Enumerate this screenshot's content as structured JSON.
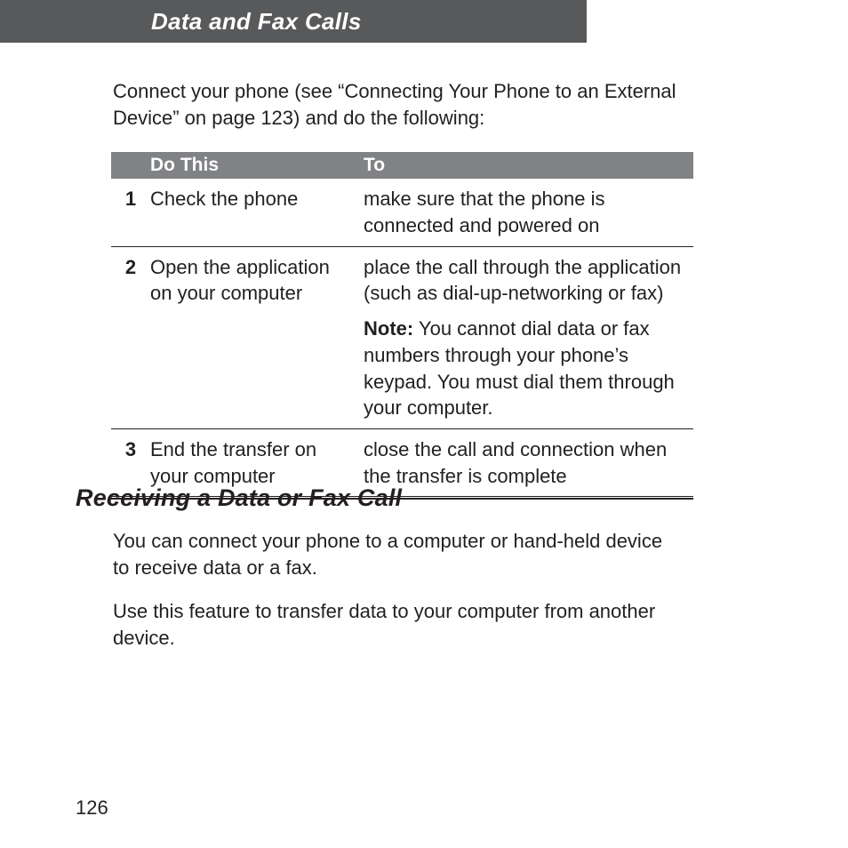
{
  "header": {
    "title": "Data and Fax Calls"
  },
  "intro": "Connect your phone (see “Connecting Your Phone to an External Device” on page 123) and do the following:",
  "table": {
    "headers": {
      "do_this": "Do This",
      "to": "To"
    },
    "rows": [
      {
        "num": "1",
        "do": "Check the phone",
        "to": "make sure that the phone is connected and powered on"
      },
      {
        "num": "2",
        "do": "Open the application on your computer",
        "to": "place the call through the application (such as dial-up-networking or fax)",
        "note_label": "Note:",
        "note": " You cannot dial data or fax numbers through your phone’s keypad. You must dial them through your computer."
      },
      {
        "num": "3",
        "do": "End the transfer on your computer",
        "to": "close the call and connection when the transfer is complete"
      }
    ]
  },
  "section": {
    "heading": "Receiving a Data or Fax Call",
    "p1": "You can connect your phone to a computer or hand-held device to receive data or a fax.",
    "p2": "Use this feature to transfer data to your computer from another device."
  },
  "page_number": "126"
}
